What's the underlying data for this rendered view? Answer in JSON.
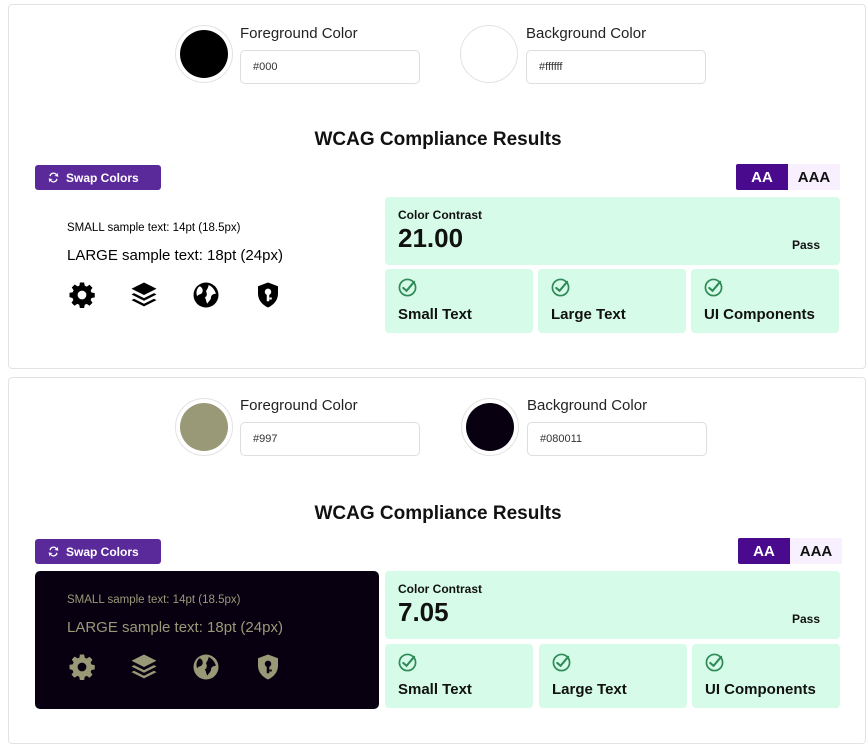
{
  "colors": {
    "accent_purple": "#5b2a9a",
    "level_active": "#4a0a8e",
    "level_inactive": "#f8f0ff",
    "pass_green": "#d6fbe8",
    "check_green": "#2e8b57"
  },
  "cards": [
    {
      "foreground": {
        "label": "Foreground Color",
        "value": "#000",
        "swatch": "#000000"
      },
      "background": {
        "label": "Background Color",
        "value": "#ffffff",
        "swatch": "#ffffff"
      },
      "results_title": "WCAG Compliance Results",
      "swap_label": "Swap Colors",
      "levels": [
        "AA",
        "AAA"
      ],
      "sample": {
        "small_text": "SMALL sample text: 14pt (18.5px)",
        "large_text": "LARGE sample text: 18pt (24px)",
        "icons": [
          "gear-icon",
          "layers-icon",
          "globe-icon",
          "shield-key-icon"
        ]
      },
      "contrast": {
        "label": "Color Contrast",
        "value": "21.00",
        "status": "Pass"
      },
      "checks": [
        "Small Text",
        "Large Text",
        "UI Components"
      ]
    },
    {
      "foreground": {
        "label": "Foreground Color",
        "value": "#997",
        "swatch": "#999977"
      },
      "background": {
        "label": "Background Color",
        "value": "#080011",
        "swatch": "#080011"
      },
      "results_title": "WCAG Compliance Results",
      "swap_label": "Swap Colors",
      "levels": [
        "AA",
        "AAA"
      ],
      "sample": {
        "small_text": "SMALL sample text: 14pt (18.5px)",
        "large_text": "LARGE sample text: 18pt (24px)",
        "icons": [
          "gear-icon",
          "layers-icon",
          "globe-icon",
          "shield-key-icon"
        ]
      },
      "contrast": {
        "label": "Color Contrast",
        "value": "7.05",
        "status": "Pass"
      },
      "checks": [
        "Small Text",
        "Large Text",
        "UI Components"
      ]
    }
  ]
}
